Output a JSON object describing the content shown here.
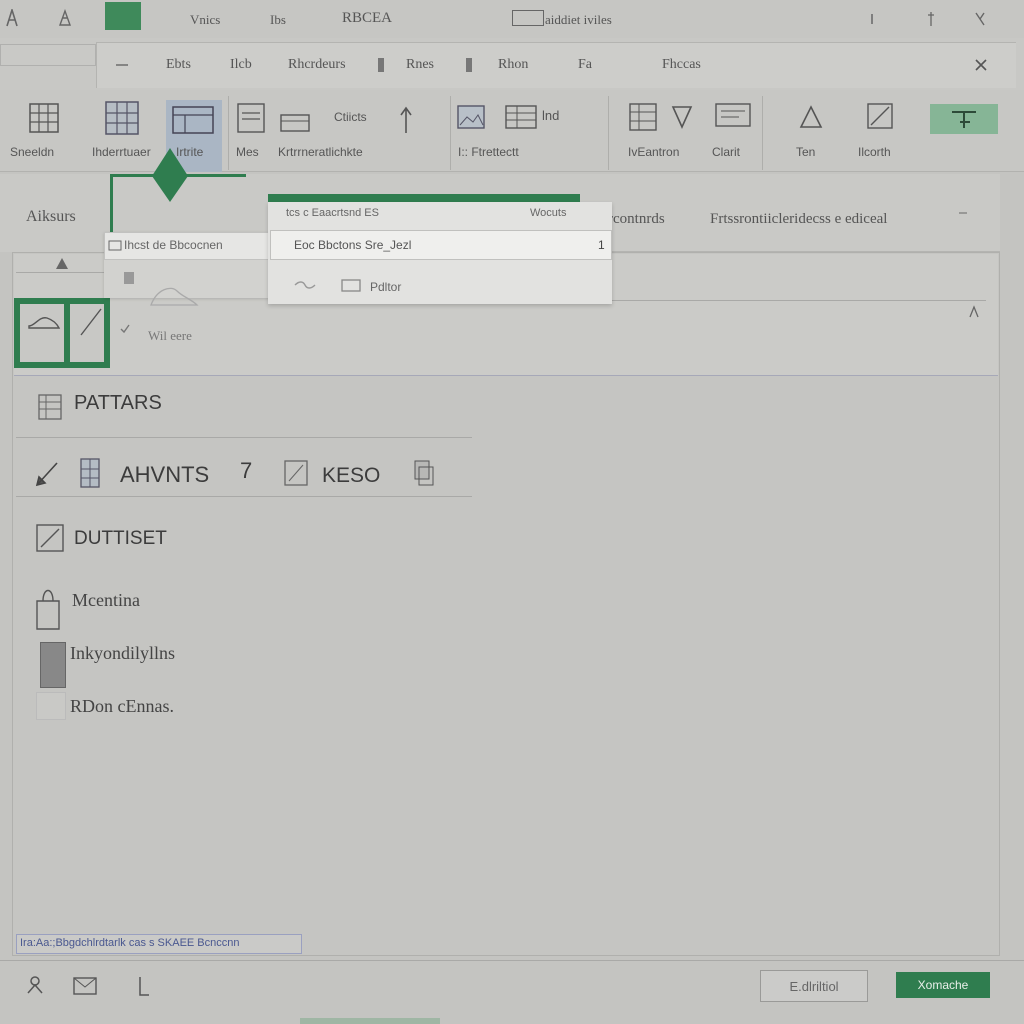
{
  "titlebar": {
    "items": [
      "Vnics",
      "Ibs",
      "RBCEA"
    ],
    "doc_title": "aiddiet iviles"
  },
  "tabs": [
    "Ebts",
    "Ilcb",
    "Rhcrdeurs",
    "Rnes",
    "Rhon",
    "Fa",
    "Fhccas"
  ],
  "ribbon": {
    "labels": [
      "Sneeldn",
      "Ihderrtuaer",
      "Irtrite",
      "Mes",
      "Krtrrneratlichkte",
      "Ctiicts",
      "I:: Ftrettectt",
      "lnd",
      "IvEantron",
      "Clarit",
      "Ten",
      "Ilcorth"
    ]
  },
  "panel": {
    "left_label": "Aiksurs",
    "right_text_1": "rcontnrds",
    "right_text_2": "Frtssrontiicleridecss e ediceal",
    "thumb_caption": "Wil eere"
  },
  "dropdown_a": {
    "item": "Ihcst de Bbcocnen"
  },
  "dropdown_b": {
    "header_left": "tcs c Eaacrtsnd ES",
    "header_right": "Wocuts",
    "selected": "Eoc Bbctons Sre_Jezl",
    "selected_count": "1",
    "item": "Pdltor"
  },
  "sections": {
    "s1": "PATTARS",
    "s2a": "AHVNTS",
    "s2b": "7",
    "s2c": "KESO",
    "s3": "DUTTISET",
    "s4": "Mcentina",
    "s5": "Inkyondilyllns",
    "s6": "RDon cEnnas."
  },
  "statusbar": {
    "field_text": "Ira:Aa:;Bbgdchlrdtarlk cas s SKAEE Bcnccnn"
  },
  "buttons": {
    "cancel": "E.dlriltiol",
    "ok": "Xomache"
  },
  "colors": {
    "accent_green": "#2f7d4f",
    "background": "#c4c4c1"
  }
}
